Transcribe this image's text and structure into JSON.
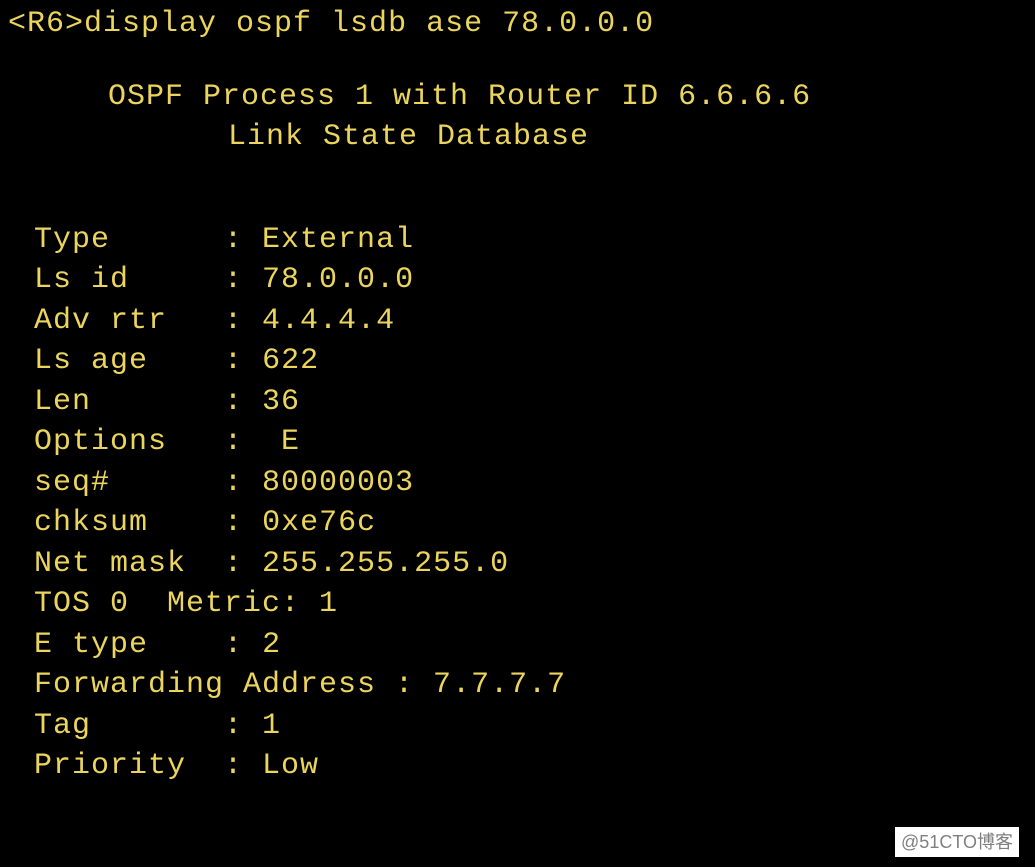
{
  "prompt": {
    "hostname": "<R6>",
    "command": "display ospf lsdb ase 78.0.0.0"
  },
  "header": {
    "line1": "OSPF Process 1 with Router ID 6.6.6.6",
    "line2": "Link State Database"
  },
  "details": {
    "type": {
      "label": "Type",
      "value": "External"
    },
    "ls_id": {
      "label": "Ls id",
      "value": "78.0.0.0"
    },
    "adv_rtr": {
      "label": "Adv rtr",
      "value": "4.4.4.4"
    },
    "ls_age": {
      "label": "Ls age",
      "value": "622"
    },
    "len": {
      "label": "Len",
      "value": "36"
    },
    "options": {
      "label": "Options",
      "value": " E"
    },
    "seq": {
      "label": "seq#",
      "value": "80000003"
    },
    "chksum": {
      "label": "chksum",
      "value": "0xe76c"
    },
    "net_mask": {
      "label": "Net mask",
      "value": "255.255.255.0"
    },
    "tos_metric": {
      "full": "TOS 0  Metric: 1"
    },
    "e_type": {
      "label": "E type",
      "value": "2"
    },
    "fwd_addr": {
      "full": "Forwarding Address : 7.7.7.7"
    },
    "tag": {
      "label": "Tag",
      "value": "1"
    },
    "priority": {
      "label": "Priority",
      "value": "Low"
    }
  },
  "watermark": "@51CTO博客"
}
